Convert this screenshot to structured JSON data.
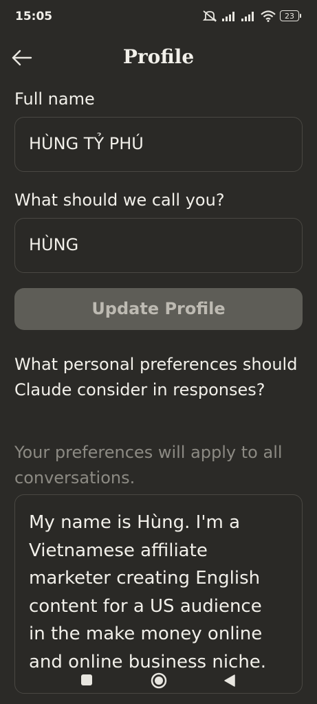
{
  "status_bar": {
    "time": "15:05",
    "battery": "23",
    "icons": [
      "mute-icon",
      "signal-icon",
      "signal-icon",
      "wifi-icon",
      "battery-icon"
    ]
  },
  "header": {
    "title": "Profile",
    "back_icon": "arrow-left-icon"
  },
  "form": {
    "full_name_label": "Full name",
    "full_name_value": "HÙNG TỶ PHÚ",
    "nickname_label": "What should we call you?",
    "nickname_value": "HÙNG",
    "update_button": "Update Profile"
  },
  "preferences": {
    "question": "What personal preferences should Claude consider in responses?",
    "helper": "Your preferences will apply to all conversations.",
    "value": "My name is Hùng. I'm a\nVietnamese affiliate\nmarketer creating English\ncontent for a US audience\nin the make money online\nand online business niche."
  },
  "nav_bar": {
    "buttons": [
      "recents-square-icon",
      "home-circle-icon",
      "back-triangle-icon"
    ]
  },
  "colors": {
    "background": "#2b2a27",
    "field_border": "#4a4843",
    "button_bg": "#5e5d57",
    "button_text": "#bdbab2",
    "helper_text": "#8c8a83"
  }
}
